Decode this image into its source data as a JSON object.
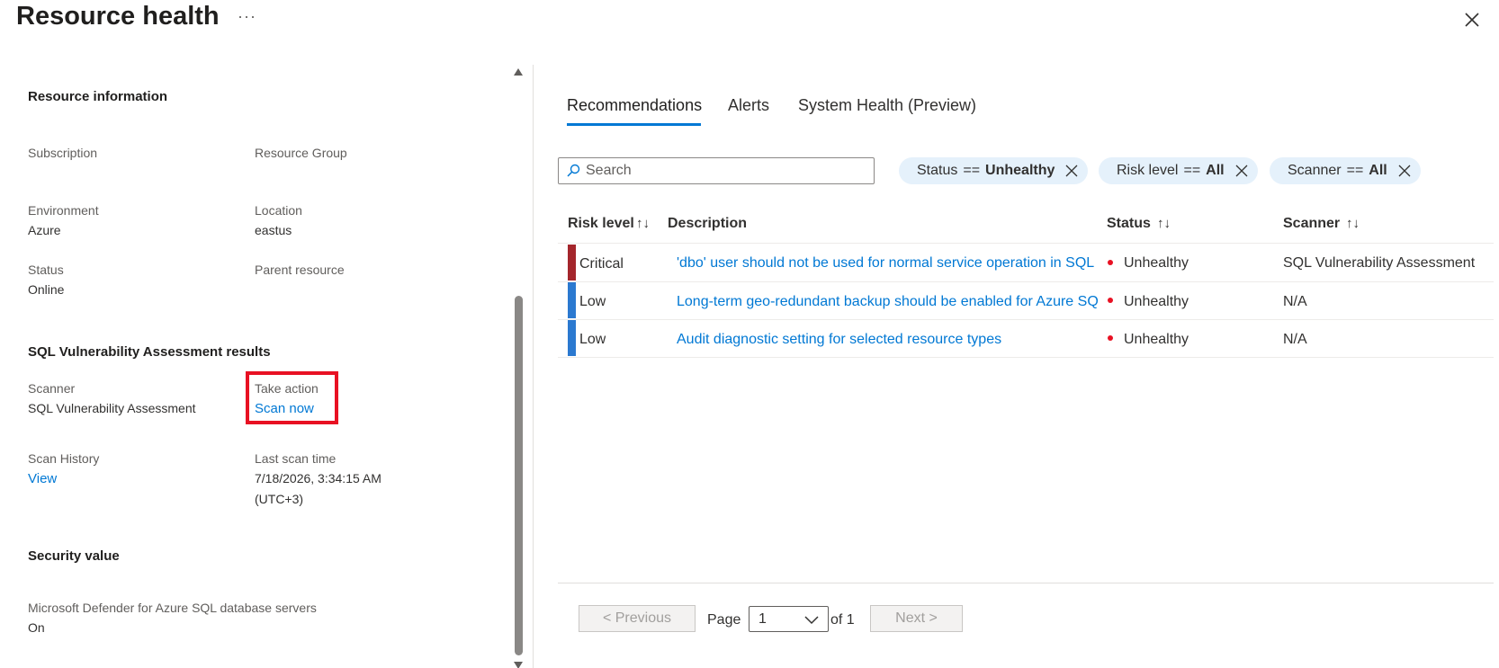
{
  "header": {
    "title": "Resource health",
    "more_label": "···"
  },
  "resource_info": {
    "title": "Resource information",
    "subscription_label": "Subscription",
    "resource_group_label": "Resource Group",
    "environment_label": "Environment",
    "environment_value": "Azure",
    "location_label": "Location",
    "location_value": "eastus",
    "status_label": "Status",
    "status_value": "Online",
    "parent_resource_label": "Parent resource"
  },
  "va_results": {
    "title": "SQL Vulnerability Assessment results",
    "scanner_label": "Scanner",
    "scanner_value": "SQL Vulnerability Assessment",
    "take_action_label": "Take action",
    "scan_now_link": "Scan now",
    "scan_history_label": "Scan History",
    "view_link": "View",
    "last_scan_label": "Last scan time",
    "last_scan_value_line1": "7/18/2026, 3:34:15 AM",
    "last_scan_value_line2": "(UTC+3)"
  },
  "security_value": {
    "title": "Security value",
    "defender_label": "Microsoft Defender for Azure SQL database servers",
    "defender_value": "On"
  },
  "tabs": [
    {
      "label": "Recommendations",
      "active": true
    },
    {
      "label": "Alerts",
      "active": false
    },
    {
      "label": "System Health (Preview)",
      "active": false
    }
  ],
  "search": {
    "placeholder": "Search"
  },
  "filters": [
    {
      "name": "Status",
      "op": "==",
      "value": "Unhealthy"
    },
    {
      "name": "Risk level",
      "op": "==",
      "value": "All"
    },
    {
      "name": "Scanner",
      "op": "==",
      "value": "All"
    }
  ],
  "table": {
    "columns": [
      "Risk level",
      "Description",
      "Status",
      "Scanner"
    ],
    "sort_glyph": "↑↓",
    "rows": [
      {
        "risk": "Critical",
        "risk_color": "#a4262c",
        "description": "'dbo' user should not be used for normal service operation in SQL",
        "status": "Unhealthy",
        "scanner": "SQL Vulnerability Assessment"
      },
      {
        "risk": "Low",
        "risk_color": "#2b79d0",
        "description": "Long-term geo-redundant backup should be enabled for Azure SQL",
        "status": "Unhealthy",
        "scanner": "N/A"
      },
      {
        "risk": "Low",
        "risk_color": "#2b79d0",
        "description": "Audit diagnostic setting for selected resource types",
        "status": "Unhealthy",
        "scanner": "N/A"
      }
    ]
  },
  "pager": {
    "previous_label": "< Previous",
    "page_label": "Page",
    "page_value": "1",
    "of_label": "of 1",
    "next_label": "Next >"
  },
  "colors": {
    "accent": "#0078d4",
    "unhealthy_dot": "#e81123",
    "highlight_border": "#e81123"
  }
}
